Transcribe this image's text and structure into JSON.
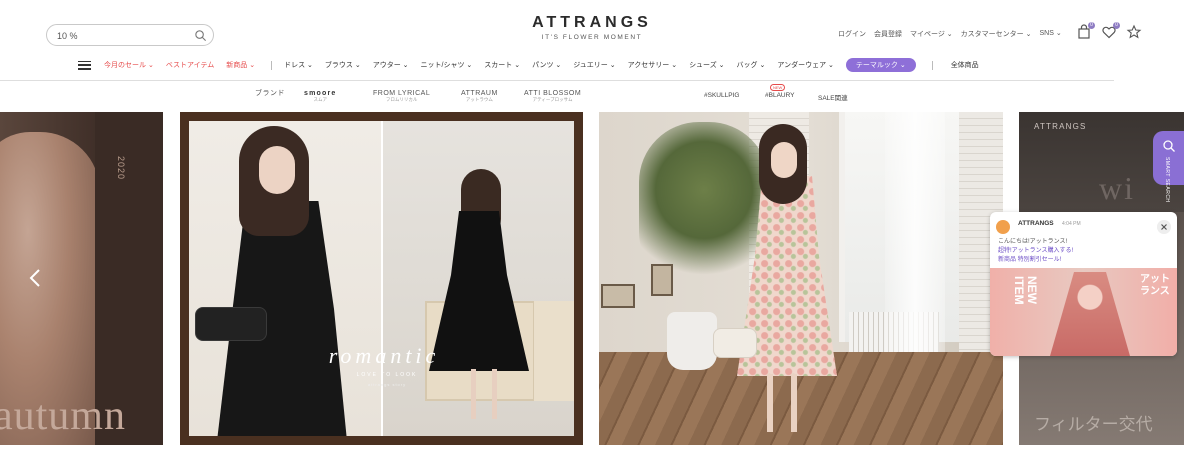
{
  "header": {
    "search": {
      "value": "10 %",
      "placeholder": ""
    },
    "logo": {
      "brand": "ATTRANGS",
      "tagline": "IT'S FLOWER MOMENT"
    },
    "utility_links": [
      "ログイン",
      "会員登録",
      "マイページ ⌄",
      "カスタマーセンター ⌄",
      "SNS ⌄"
    ],
    "cart_badge": "0",
    "wish_badge": "0"
  },
  "nav": {
    "highlights": [
      "今月のセール ⌄",
      "ベストアイテム",
      "新商品 ⌄"
    ],
    "categories": [
      "ドレス ⌄",
      "ブラウス ⌄",
      "アウター ⌄",
      "ニット/シャツ ⌄",
      "スカート ⌄",
      "パンツ ⌄",
      "ジュエリー ⌄",
      "アクセサリー ⌄",
      "シューズ ⌄",
      "バッグ ⌄",
      "アンダーウェア ⌄"
    ],
    "theme_pill": "テーマルック ⌄",
    "all_products": "全体商品"
  },
  "brand_strip": {
    "brands": [
      {
        "main": "ブランド",
        "sub": ""
      },
      {
        "main": "smoore",
        "sub": "スムア"
      },
      {
        "main": "FROM LYRICAL",
        "sub": "フロムリリカル"
      },
      {
        "main": "ATTRAUM",
        "sub": "アットラウム"
      },
      {
        "main": "ATTI BLOSSOM",
        "sub": "アティーブロッサム"
      }
    ],
    "tags": [
      "#SKULLPIG",
      "#BLAURY",
      "SALE関連"
    ],
    "new_badge": "NEW"
  },
  "slides": {
    "s1": {
      "year": "2020",
      "headline": "autumn"
    },
    "s2": {
      "script": "romantic",
      "line1": "LOVE TO LOOK",
      "line2": "attrangs story"
    },
    "s4": {
      "label": "ATTRANGS",
      "wi": "wi",
      "japanese": "フィルター交代"
    }
  },
  "smart_search": {
    "label": "SMART SEARCH"
  },
  "chat": {
    "name": "ATTRANGS",
    "time": "4:04 PM",
    "lines": [
      "こんにちは!アットランス!",
      "超特!アットランス購入する!",
      "新商品 特別割引セール!"
    ],
    "banner_left": "NEW ITEM",
    "banner_right": "アットランス"
  }
}
